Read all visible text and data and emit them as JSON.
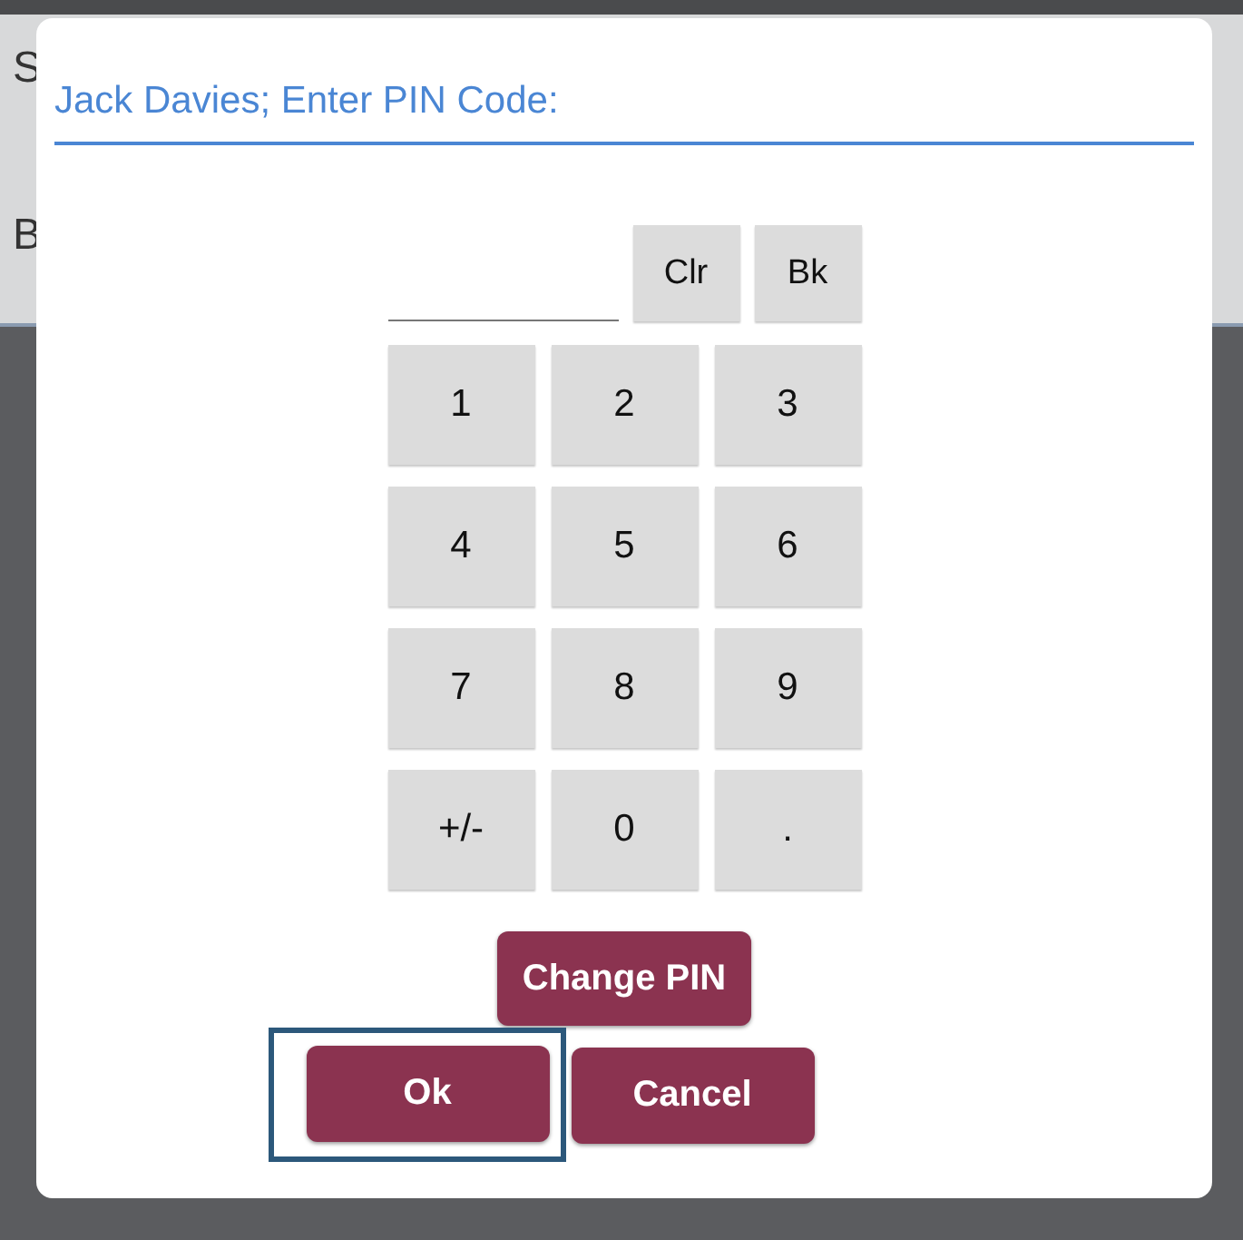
{
  "background": {
    "texts": [
      "S",
      "B"
    ]
  },
  "dialog": {
    "title": "Jack Davies; Enter PIN Code:",
    "edit_keys": [
      "Clr",
      "Bk"
    ],
    "keypad": [
      [
        "1",
        "2",
        "3"
      ],
      [
        "4",
        "5",
        "6"
      ],
      [
        "7",
        "8",
        "9"
      ],
      [
        "+/-",
        "0",
        "."
      ]
    ],
    "buttons": [
      {
        "label": "Change PIN",
        "focused": false
      },
      {
        "label": "Ok",
        "focused": true
      },
      {
        "label": "Cancel",
        "focused": false
      }
    ]
  }
}
